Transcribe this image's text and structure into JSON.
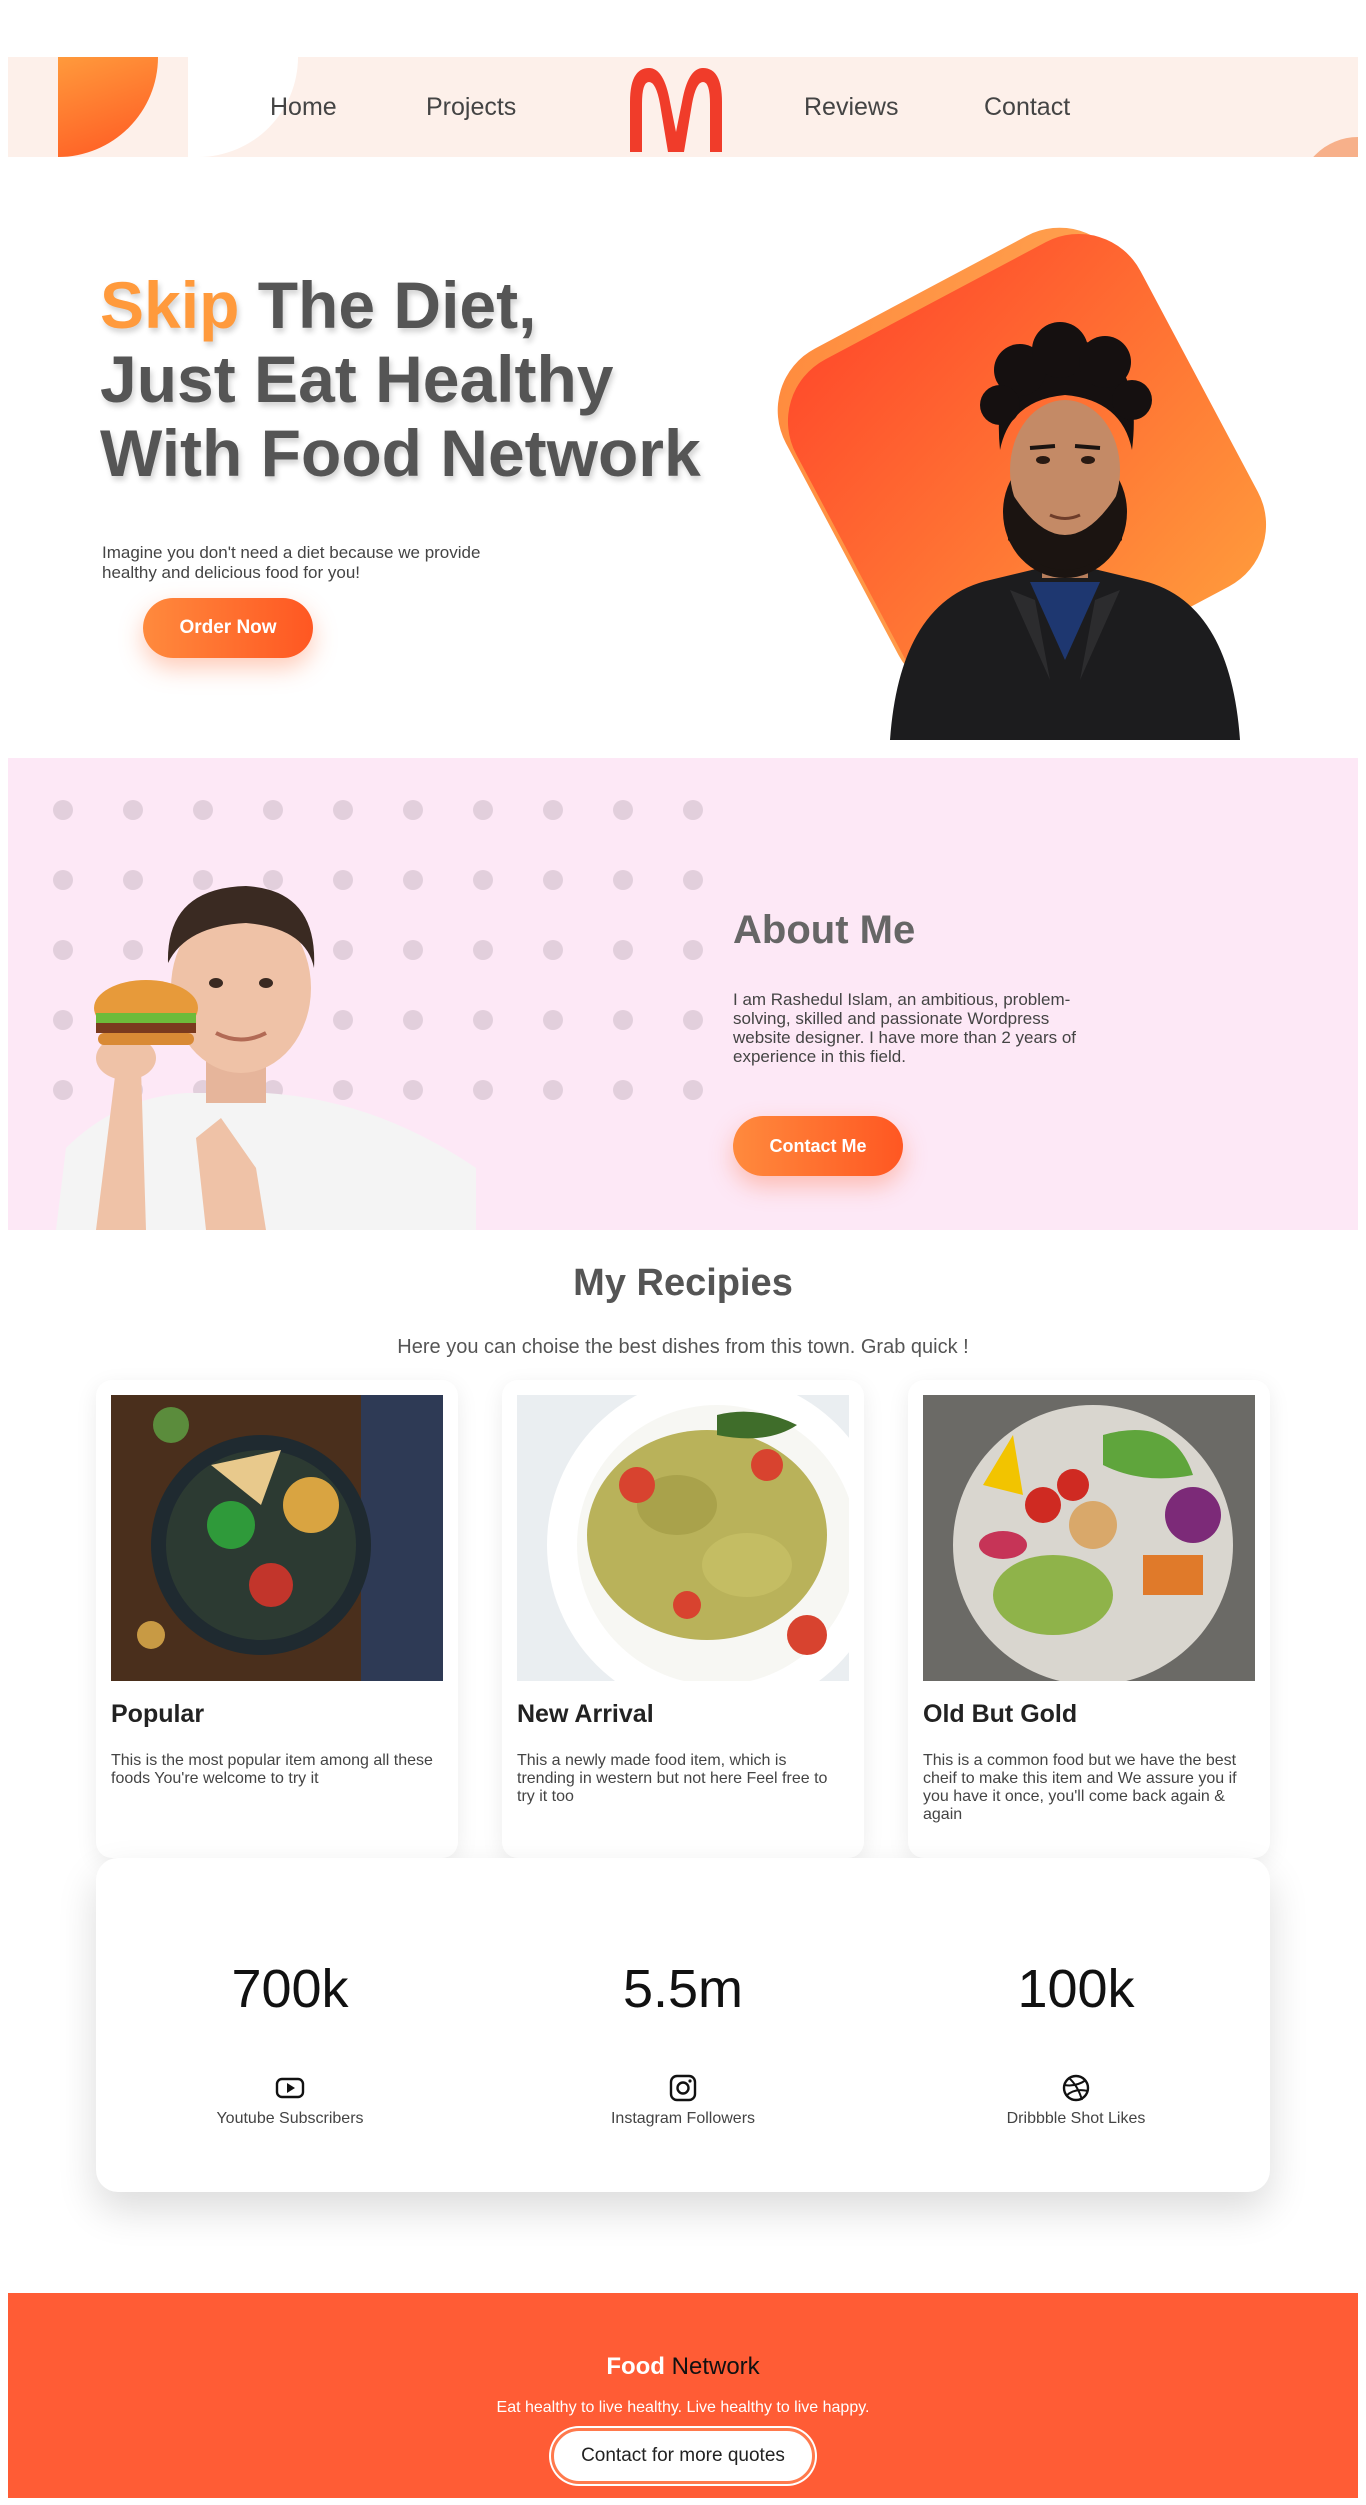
{
  "nav": {
    "items": [
      {
        "label": "Home"
      },
      {
        "label": "Projects"
      },
      {
        "label": "Reviews"
      },
      {
        "label": "Contact"
      }
    ],
    "logo_icon": "golden-arches-logo"
  },
  "hero": {
    "title_accent": "Skip",
    "title_line1_rest": " The Diet,",
    "title_line2": "Just Eat Healthy",
    "title_line3": "With Food Network",
    "description": "Imagine you don't need a diet because we provide healthy and delicious food for you!",
    "cta_label": "Order Now"
  },
  "about": {
    "title": "About Me",
    "description": "I am Rashedul Islam, an ambitious, problem-solving, skilled and passionate Wordpress website designer. I have more than 2 years of experience in this field.",
    "cta_label": "Contact Me"
  },
  "recipes": {
    "title": "My Recipies",
    "subtitle": "Here you can choise the best dishes from this town. Grab quick !",
    "cards": [
      {
        "title": "Popular",
        "description": "This is the most popular item among all these foods You're welcome to try it"
      },
      {
        "title": "New Arrival",
        "description": "This a newly made food item, which is trending in western but not here Feel free to try it too"
      },
      {
        "title": "Old But Gold",
        "description": "This is a common food but we have the best cheif to make this item and We assure you if you have it once, you'll come back again & again"
      }
    ]
  },
  "stats": [
    {
      "value": "700k",
      "label": "Youtube Subscribers",
      "icon": "youtube-icon"
    },
    {
      "value": "5.5m",
      "label": "Instagram Followers",
      "icon": "instagram-icon"
    },
    {
      "value": "100k",
      "label": "Dribbble Shot Likes",
      "icon": "dribbble-icon"
    }
  ],
  "footer": {
    "brand_white": "Food",
    "brand_dark": " Network",
    "tagline": "Eat healthy to live healthy. Live healthy to live happy.",
    "cta_label": "Contact for more quotes"
  },
  "colors": {
    "accent": "#ff5722",
    "accent_light": "#ff9a3c",
    "nav_bg": "#fdf0ea",
    "about_bg": "#fde8f6",
    "footer_bg": "#ff5c35"
  }
}
